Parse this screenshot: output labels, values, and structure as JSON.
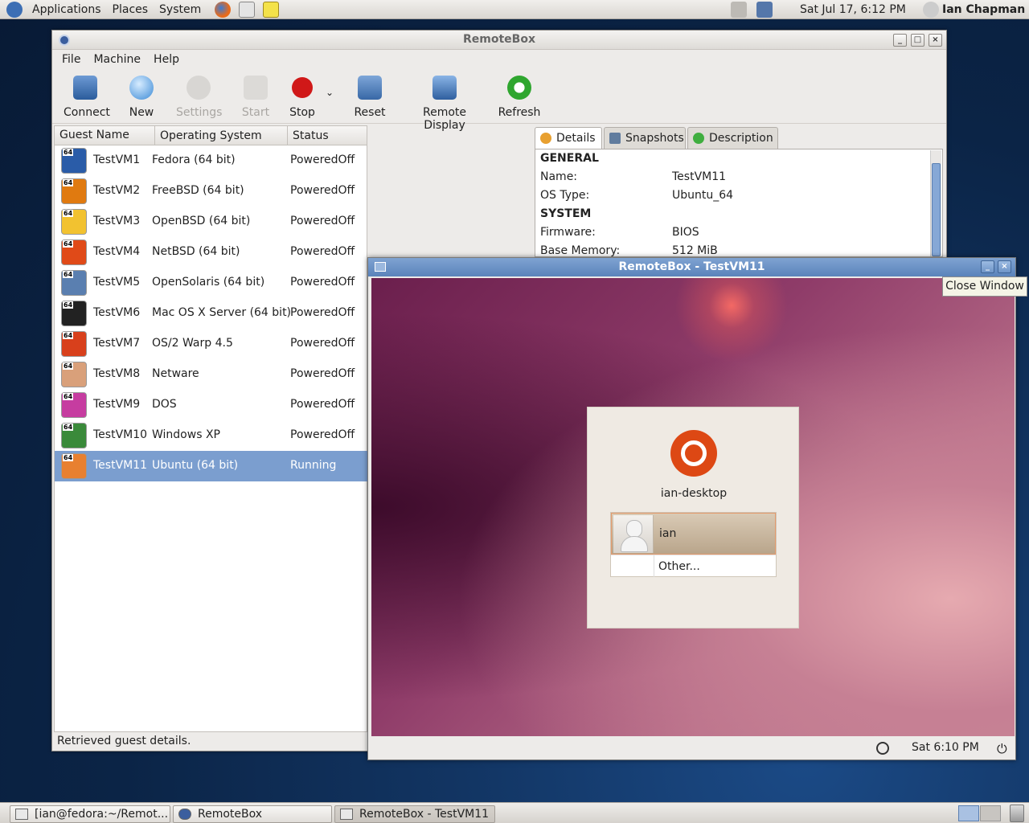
{
  "top_panel": {
    "menus": [
      "Applications",
      "Places",
      "System"
    ],
    "clock": "Sat Jul 17,  6:12 PM",
    "user": "Ian Chapman"
  },
  "main_window": {
    "title": "RemoteBox",
    "menu": [
      "File",
      "Machine",
      "Help"
    ],
    "toolbar": {
      "connect": "Connect",
      "new": "New",
      "settings": "Settings",
      "start": "Start",
      "stop": "Stop",
      "reset": "Reset",
      "remote_display": "Remote Display",
      "refresh": "Refresh"
    },
    "columns": [
      "Guest Name",
      "Operating System",
      "Status"
    ],
    "guests": [
      {
        "name": "TestVM1",
        "os": "Fedora (64 bit)",
        "status": "PoweredOff",
        "color": "#2a5ca8"
      },
      {
        "name": "TestVM2",
        "os": "FreeBSD (64 bit)",
        "status": "PoweredOff",
        "color": "#e07a10"
      },
      {
        "name": "TestVM3",
        "os": "OpenBSD (64 bit)",
        "status": "PoweredOff",
        "color": "#f2c230"
      },
      {
        "name": "TestVM4",
        "os": "NetBSD (64 bit)",
        "status": "PoweredOff",
        "color": "#e04a18"
      },
      {
        "name": "TestVM5",
        "os": "OpenSolaris (64 bit)",
        "status": "PoweredOff",
        "color": "#5a7fb0"
      },
      {
        "name": "TestVM6",
        "os": "Mac OS X Server (64 bit)",
        "status": "PoweredOff",
        "color": "#222222"
      },
      {
        "name": "TestVM7",
        "os": "OS/2 Warp 4.5",
        "status": "PoweredOff",
        "color": "#d8401c"
      },
      {
        "name": "TestVM8",
        "os": "Netware",
        "status": "PoweredOff",
        "color": "#d9a07a"
      },
      {
        "name": "TestVM9",
        "os": "DOS",
        "status": "PoweredOff",
        "color": "#c63ca0"
      },
      {
        "name": "TestVM10",
        "os": "Windows XP",
        "status": "PoweredOff",
        "color": "#3a8a3a"
      },
      {
        "name": "TestVM11",
        "os": "Ubuntu (64 bit)",
        "status": "Running",
        "color": "#e88030"
      }
    ],
    "status_text": "Retrieved guest details.",
    "tabs": [
      "Details",
      "Snapshots",
      "Description"
    ],
    "details": {
      "general_header": "GENERAL",
      "name_label": "Name:",
      "name_value": "TestVM11",
      "ostype_label": "OS Type:",
      "ostype_value": "Ubuntu_64",
      "system_header": "SYSTEM",
      "firmware_label": "Firmware:",
      "firmware_value": "BIOS",
      "memory_label": "Base Memory:",
      "memory_value": "512 MiB"
    }
  },
  "remote_window": {
    "title": "RemoteBox - TestVM11",
    "tooltip": "Close Window",
    "hostname": "ian-desktop",
    "user": "ian",
    "other": "Other...",
    "guest_clock": "Sat  6:10 PM"
  },
  "taskbar": [
    "[ian@fedora:~/Remot...",
    "RemoteBox",
    "RemoteBox - TestVM11"
  ]
}
